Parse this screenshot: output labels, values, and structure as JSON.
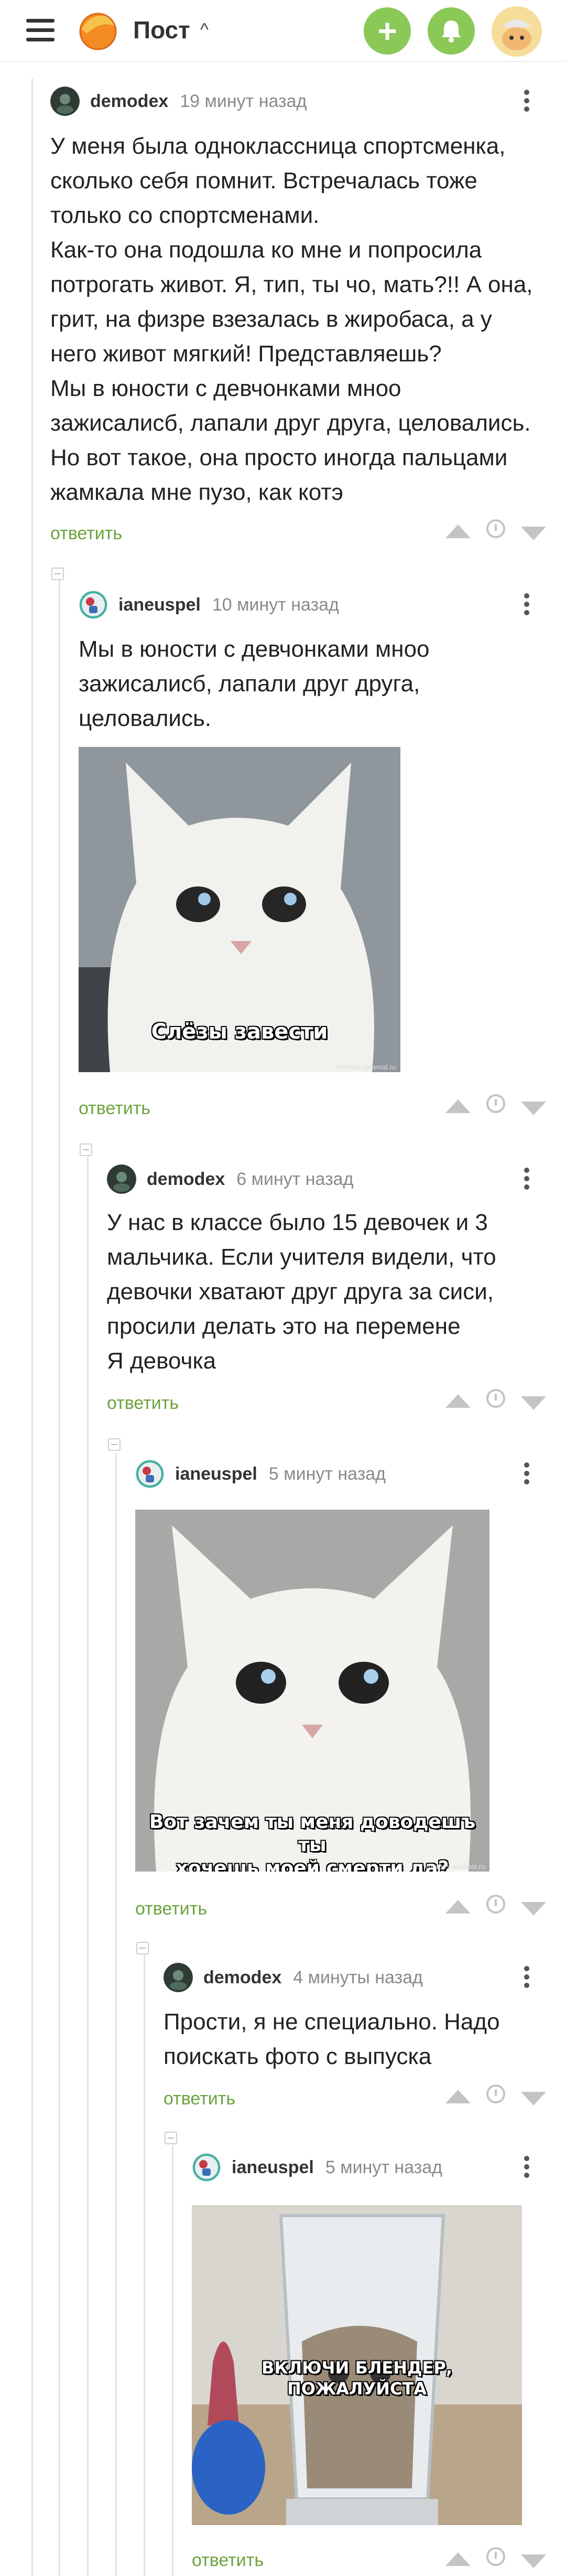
{
  "header": {
    "title": "Пост",
    "caret": "^",
    "add_icon": "plus-icon",
    "bell_icon": "bell-icon",
    "menu_icon": "hamburger-icon"
  },
  "comments": [
    {
      "author": "demodex",
      "time": "19 минут назад",
      "lines": [
        "У меня была одноклассница спортсменка,",
        "сколько себя помнит. Встречалась тоже",
        "только со спортсменами.",
        "Как-то она подошла ко мне и попросила",
        "потрогать живот. Я, тип, ты чо, мать?!! А она,",
        "грит, на физре взезалась в жиробаса, а у",
        "него живот мягкий! Представляешь?",
        "Мы в юности с девчонками мноо",
        "зажисалисб, лапали друг друга, целовались.",
        "Но вот такое, она просто иногда пальцами",
        "жамкала мне пузо, как котэ"
      ],
      "reply": "ответить"
    },
    {
      "author": "ianeuspel",
      "time": "10 минут назад",
      "lines": [
        "Мы в юности с девчонками мноо",
        "зажисалисб, лапали друг друга,",
        "целовались."
      ],
      "image_caption": "Слёзы завести",
      "image_watermark": "memes-arsenal.ru",
      "reply": "ответить"
    },
    {
      "author": "demodex",
      "time": "6 минут назад",
      "lines": [
        "У нас в классе было 15 девочек и 3",
        "мальчика. Если учителя видели, что",
        "девочки хватают друг друга за сиси,",
        "просили делать это на перемене",
        "Я девочка"
      ],
      "reply": "ответить"
    },
    {
      "author": "ianeuspel",
      "time": "5 минут назад",
      "lines": [],
      "image_caption_1": "Вот зачем ты меня доводешъ ты",
      "image_caption_2": "хочешь моей смерти да?",
      "image_watermark": "memes-arsenal.ru",
      "reply": "ответить"
    },
    {
      "author": "demodex",
      "time": "4 минуты назад",
      "lines": [
        "Прости, я не специально. Надо",
        "поискать фото с выпуска"
      ],
      "reply": "ответить"
    },
    {
      "author": "ianeuspel",
      "time": "5 минут назад",
      "lines": [],
      "image_caption_1": "ВКЛЮЧИ БЛЕНДЕР,",
      "image_caption_2": "ПОЖАЛУЙСТА",
      "reply": "ответить"
    }
  ],
  "colors": {
    "accent_green": "#8ac858",
    "reply_green": "#6ba33e",
    "muted": "#8a8a8a",
    "icon_gray": "#c4c4c4"
  }
}
